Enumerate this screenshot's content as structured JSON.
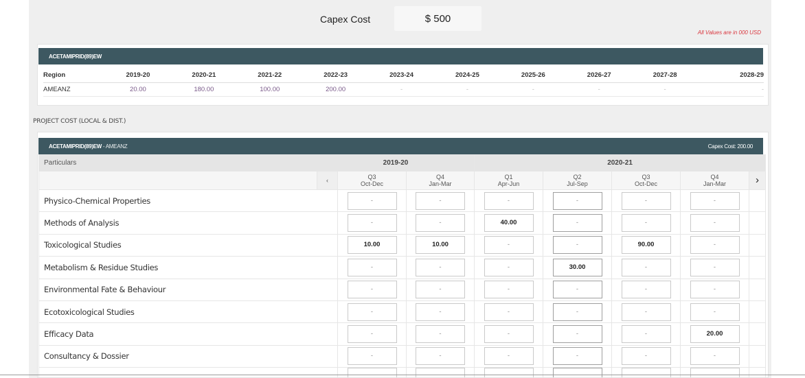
{
  "capex": {
    "label": "Capex Cost",
    "value": "$ 500"
  },
  "note": "All Values are in 000 USD",
  "summary": {
    "product": "ACETAMIPRID(89)EW",
    "headers": [
      "Region",
      "2019-20",
      "2020-21",
      "2021-22",
      "2022-23",
      "2023-24",
      "2024-25",
      "2025-26",
      "2026-27",
      "2027-28",
      "2028-29"
    ],
    "row": [
      "AMEANZ",
      "20.00",
      "180.00",
      "100.00",
      "200.00",
      "-",
      "-",
      "-",
      "-",
      "-",
      "-"
    ]
  },
  "section_title": "PROJECT COST (LOCAL & DIST.)",
  "detail": {
    "product": "ACETAMIPRID(89)EW",
    "region": " - AMEANZ",
    "capex_text": "Capex Cost:  200.00",
    "particulars_label": "Particulars",
    "years": [
      "2019-20",
      "2020-21"
    ],
    "quarters": [
      {
        "q": "Q3",
        "months": "Oct-Dec"
      },
      {
        "q": "Q4",
        "months": "Jan-Mar"
      },
      {
        "q": "Q1",
        "months": "Apr-Jun"
      },
      {
        "q": "Q2",
        "months": "Jul-Sep"
      },
      {
        "q": "Q3",
        "months": "Oct-Dec"
      },
      {
        "q": "Q4",
        "months": "Jan-Mar"
      }
    ],
    "nav_prev": "‹",
    "nav_next": "›",
    "rows": [
      {
        "label": "Physico-Chemical Properties",
        "values": [
          "-",
          "-",
          "-",
          "-",
          "-",
          "-"
        ]
      },
      {
        "label": "Methods of Analysis",
        "values": [
          "-",
          "-",
          "40.00",
          "-",
          "-",
          "-"
        ]
      },
      {
        "label": "Toxicological Studies",
        "values": [
          "10.00",
          "10.00",
          "-",
          "-",
          "90.00",
          "-"
        ]
      },
      {
        "label": "Metabolism & Residue Studies",
        "values": [
          "-",
          "-",
          "-",
          "30.00",
          "-",
          "-"
        ]
      },
      {
        "label": "Environmental Fate & Behaviour",
        "values": [
          "-",
          "-",
          "-",
          "-",
          "-",
          "-"
        ]
      },
      {
        "label": "Ecotoxicological Studies",
        "values": [
          "-",
          "-",
          "-",
          "-",
          "-",
          "-"
        ]
      },
      {
        "label": "Efficacy Data",
        "values": [
          "-",
          "-",
          "-",
          "-",
          "-",
          "20.00"
        ]
      },
      {
        "label": "Consultancy & Dossier",
        "values": [
          "-",
          "-",
          "-",
          "-",
          "-",
          "-"
        ]
      },
      {
        "label": "",
        "values": [
          "",
          "",
          "",
          "",
          "",
          ""
        ]
      }
    ]
  }
}
